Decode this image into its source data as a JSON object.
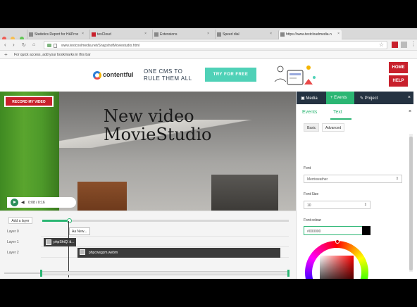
{
  "browser": {
    "tabs": [
      {
        "label": "Statistics Report for HAProx"
      },
      {
        "label": "tesCloud"
      },
      {
        "label": "Extensions"
      },
      {
        "label": "Speed dial"
      },
      {
        "label": "https://www.testcloudmedia.n"
      }
    ],
    "url": "www.testcoolmedia.net/SnapshotMoviestudio.html",
    "bookmarks_hint": "For quick access, add your bookmarks in this bar"
  },
  "ad": {
    "brand": "contentful",
    "tagline": "ONE CMS TO RULE THEM ALL",
    "cta": "TRY FOR FREE"
  },
  "sidebar_buttons": {
    "home": "HOME",
    "help": "HELP"
  },
  "video": {
    "record_label": "RECORD MY VIDEO",
    "title_line1": "New video",
    "title_line2": "MovieStudio",
    "time": "0:08 / 0:16"
  },
  "timeline": {
    "add_layer": "Add a layer",
    "layers": [
      "Layer 0",
      "Layer 1",
      "Layer 2"
    ],
    "clips": {
      "text": "Aa New...",
      "clip_a": "phpShtQ2d...",
      "clip_b": "phpcwsgzm.webm"
    },
    "progress": 0.11
  },
  "panel": {
    "tabs": {
      "media": "Media",
      "events": "Events",
      "project": "Project"
    },
    "subtabs": {
      "events": "Events",
      "text": "Text"
    },
    "basic_tabs": {
      "basic": "Basic",
      "advanced": "Advanced"
    },
    "font_label": "Font",
    "font_value": "Merriweather",
    "font_size_label": "Font Size",
    "font_size_value": "10",
    "font_colour_label": "Font colour",
    "font_colour_value": "#000000"
  },
  "colors": {
    "accent": "#2bb673",
    "brand_red": "#c8202c",
    "panel_dark": "#243241"
  }
}
